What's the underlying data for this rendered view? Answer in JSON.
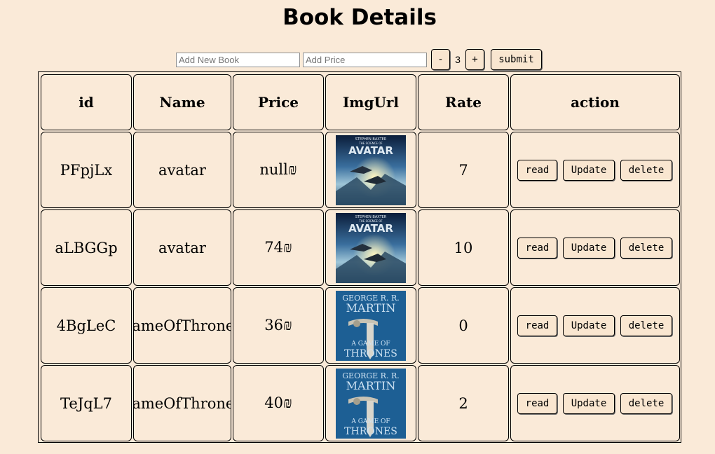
{
  "page": {
    "title": "Book Details"
  },
  "controls": {
    "book_placeholder": "Add New Book",
    "price_placeholder": "Add Price",
    "decrement_label": "-",
    "quantity": "3",
    "increment_label": "+",
    "submit_label": "submit"
  },
  "table": {
    "headers": [
      "id",
      "Name",
      "Price",
      "ImgUrl",
      "Rate",
      "action"
    ],
    "rows": [
      {
        "id": "PFpjLx",
        "name": "avatar",
        "price": "null₪",
        "cover": "avatar",
        "rate": "7"
      },
      {
        "id": "aLBGGp",
        "name": "avatar",
        "price": "74₪",
        "cover": "avatar",
        "rate": "10"
      },
      {
        "id": "4BgLeC",
        "name": "gameOfThrones",
        "price": "36₪",
        "cover": "game-of-thrones",
        "rate": "0"
      },
      {
        "id": "TeJqL7",
        "name": "gameOfThrones",
        "price": "40₪",
        "cover": "game-of-thrones",
        "rate": "2"
      }
    ],
    "actions": {
      "read": "read",
      "update": "Update",
      "delete": "delete"
    }
  },
  "covers": {
    "avatar": {
      "author": "STEPHEN BAXTER",
      "subtitle": "THE SCIENCE OF",
      "title": "AVATAR"
    },
    "game-of-thrones": {
      "author_line1": "GEORGE R. R.",
      "author_line2": "MARTIN",
      "title_line1": "A GAME OF",
      "title_line2": "THRONES"
    }
  },
  "colors": {
    "background": "#faead8",
    "button_bg": "#f9e6d0"
  }
}
